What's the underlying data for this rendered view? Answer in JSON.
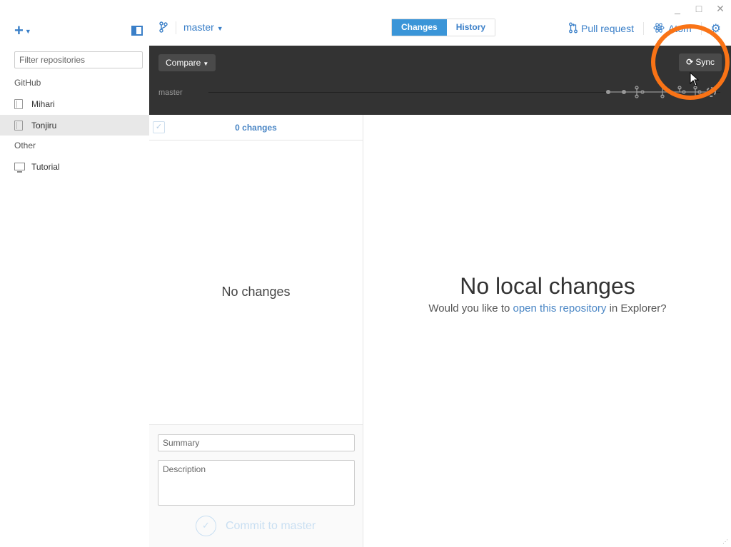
{
  "window": {
    "controls": {
      "minimize": "_",
      "maximize": "□",
      "close": "✕"
    }
  },
  "sidebar": {
    "add_icon": "+",
    "filter": {
      "placeholder": "Filter repositories",
      "value": ""
    },
    "groups": [
      {
        "label": "GitHub",
        "items": [
          {
            "label": "Mihari",
            "icon": "repo-icon",
            "selected": false
          },
          {
            "label": "Tonjiru",
            "icon": "repo-icon",
            "selected": true
          }
        ]
      },
      {
        "label": "Other",
        "items": [
          {
            "label": "Tutorial",
            "icon": "computer-icon",
            "selected": false
          }
        ]
      }
    ]
  },
  "topbar": {
    "branch_icon": "branch-icon",
    "branch": "master",
    "tabs": [
      {
        "label": "Changes",
        "active": true
      },
      {
        "label": "History",
        "active": false
      }
    ],
    "pull_request": "Pull request",
    "editor": "Atom",
    "settings_icon": "gear-icon"
  },
  "compare_bar": {
    "compare_label": "Compare",
    "sync_label": "Sync",
    "branch_label": "master"
  },
  "changes": {
    "count_label": "0 changes",
    "empty_label": "No changes",
    "summary_placeholder": "Summary",
    "description_placeholder": "Description",
    "commit_label": "Commit to master"
  },
  "main": {
    "title": "No local changes",
    "sub_before": "Would you like to ",
    "sub_link": "open this repository",
    "sub_after": " in Explorer?"
  },
  "colors": {
    "accent": "#3a7fc8",
    "tab_active": "#3a95d8",
    "dark_bar": "#333333",
    "highlight": "#f97316"
  }
}
